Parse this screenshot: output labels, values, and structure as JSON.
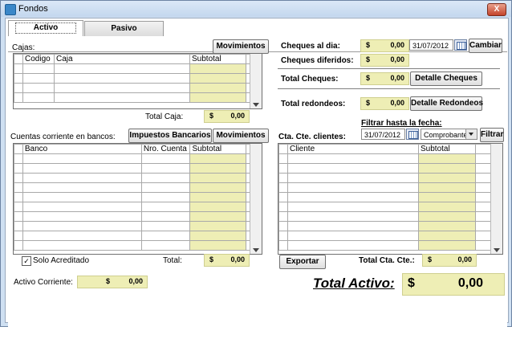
{
  "window": {
    "title": "Fondos",
    "close_label": "X"
  },
  "tabs": [
    {
      "label": "Activo"
    },
    {
      "label": "Pasivo"
    }
  ],
  "cajas": {
    "label": "Cajas:",
    "movimientos": "Movimientos",
    "columns": [
      "Codigo",
      "Caja",
      "Subtotal"
    ],
    "total_label": "Total Caja:",
    "total_currency": "$",
    "total_value": "0,00"
  },
  "cuentas": {
    "label": "Cuentas corriente en bancos:",
    "impuestos": "Impuestos Bancarios",
    "movimientos": "Movimientos",
    "columns": [
      "Banco",
      "Nro. Cuenta",
      "Subtotal"
    ],
    "solo_acreditado": "Solo Acreditado",
    "solo_checked": true,
    "total_label": "Total:",
    "total_currency": "$",
    "total_value": "0,00"
  },
  "activo_corriente": {
    "label": "Activo Corriente:",
    "currency": "$",
    "value": "0,00"
  },
  "cheques": {
    "al_dia_label": "Cheques al dia:",
    "al_dia_currency": "$",
    "al_dia_value": "0,00",
    "date": "31/07/2012",
    "cambiar": "Cambiar",
    "diferidos_label": "Cheques diferidos:",
    "diferidos_currency": "$",
    "diferidos_value": "0,00",
    "total_label": "Total Cheques:",
    "total_currency": "$",
    "total_value": "0,00",
    "detalle": "Detalle Cheques"
  },
  "redondeos": {
    "label": "Total redondeos:",
    "currency": "$",
    "value": "0,00",
    "detalle": "Detalle Redondeos"
  },
  "clientes": {
    "filter_label": "Filtrar hasta la fecha:",
    "label": "Cta. Cte. clientes:",
    "date": "31/07/2012",
    "combo": "Comprobante",
    "filtrar": "Filtrar",
    "columns": [
      "Cliente",
      "Subtotal"
    ],
    "exportar": "Exportar",
    "total_label": "Total Cta. Cte.:",
    "total_currency": "$",
    "total_value": "0,00"
  },
  "total_activo": {
    "label": "Total Activo:",
    "currency": "$",
    "value": "0,00"
  }
}
